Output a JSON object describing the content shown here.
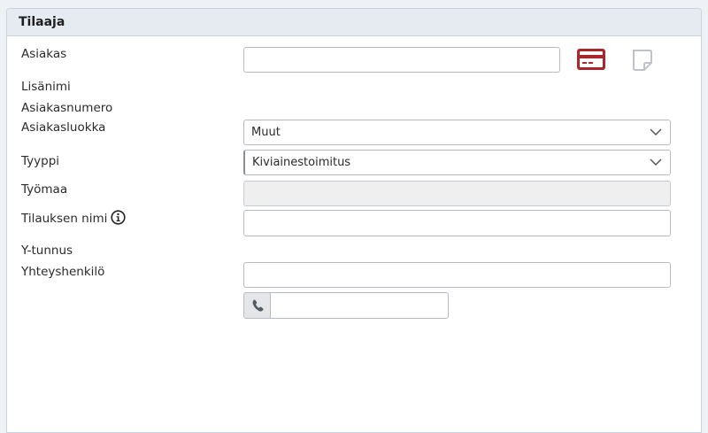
{
  "panel": {
    "title": "Tilaaja"
  },
  "labels": {
    "asiakas": "Asiakas",
    "lisanimi": "Lisänimi",
    "asiakasnumero": "Asiakasnumero",
    "asiakasluokka": "Asiakasluokka",
    "tyyppi": "Tyyppi",
    "tyomaa": "Työmaa",
    "tilauksen_nimi": "Tilauksen nimi",
    "y_tunnus": "Y-tunnus",
    "yhteyshenkilo": "Yhteyshenkilö"
  },
  "fields": {
    "asiakas_value": "",
    "asiakasluokka_selected": "Muut",
    "tyyppi_selected": "Kiviainestoimitus",
    "tyomaa_value": "",
    "tilauksen_nimi_value": "",
    "yhteyshenkilo_value": "",
    "phone_value": ""
  },
  "icons": {
    "customer_card": "credit-card-icon",
    "note": "note-icon",
    "info": "info-icon",
    "phone": "phone-icon",
    "dropdown": "chevron-down-icon"
  },
  "colors": {
    "card_icon": "#a8262c",
    "note_icon": "#bfc3c8",
    "header_bg": "#e6ebf2"
  }
}
